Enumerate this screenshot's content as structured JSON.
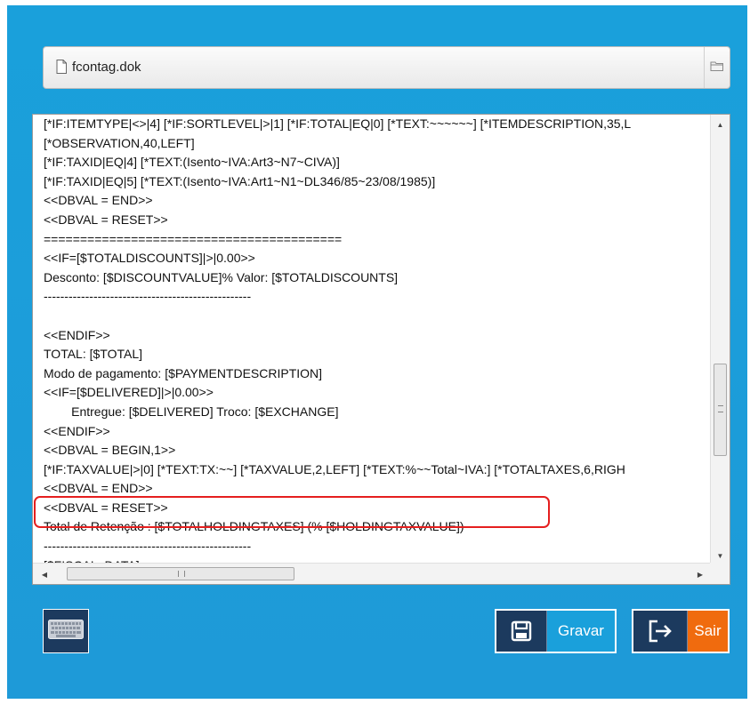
{
  "file_bar": {
    "filename": "fcontag.dok",
    "doc_icon": "document-icon",
    "folder_icon": "folder-icon"
  },
  "editor": {
    "lines": [
      "[*IF:ITEMTYPE|<>|4] [*IF:SORTLEVEL|>|1] [*IF:TOTAL|EQ|0] [*TEXT:~~~~~~] [*ITEMDESCRIPTION,35,L",
      "[*OBSERVATION,40,LEFT]",
      "[*IF:TAXID|EQ|4] [*TEXT:(Isento~IVA:Art3~N7~CIVA)]",
      "[*IF:TAXID|EQ|5] [*TEXT:(Isento~IVA:Art1~N1~DL346/85~23/08/1985)]",
      "<<DBVAL = END>>",
      "<<DBVAL = RESET>>",
      "=========================================",
      "<<IF=[$TOTALDISCOUNTS]|>|0.00>>",
      "Desconto: [$DISCOUNTVALUE]% Valor: [$TOTALDISCOUNTS]",
      "--------------------------------------------------",
      "",
      "<<ENDIF>>",
      "TOTAL: [$TOTAL]",
      "Modo de pagamento: [$PAYMENTDESCRIPTION]",
      "<<IF=[$DELIVERED]|>|0.00>>",
      "        Entregue: [$DELIVERED] Troco: [$EXCHANGE]",
      "<<ENDIF>>",
      "<<DBVAL = BEGIN,1>>",
      "[*IF:TAXVALUE|>|0] [*TEXT:TX:~~] [*TAXVALUE,2,LEFT] [*TEXT:%~~Total~IVA:] [*TOTALTAXES,6,RIGH",
      "<<DBVAL = END>>",
      "<<DBVAL = RESET>>",
      "Total de Retenção : [$TOTALHOLDINGTAXES] (% [$HOLDINGTAXVALUE])",
      "--------------------------------------------------",
      "[$FISCAL_DATA]"
    ]
  },
  "scrollbars": {
    "up_arrow": "▲",
    "down_arrow": "▼",
    "left_arrow": "◀",
    "right_arrow": "▶",
    "h_grip": "III"
  },
  "buttons": {
    "keyboard_icon": "keyboard-icon",
    "save_label": "Gravar",
    "save_icon": "floppy-disk-icon",
    "exit_label": "Sair",
    "exit_icon": "exit-icon"
  },
  "colors": {
    "background": "#1aa0db",
    "dark_button": "#1c3a5e",
    "save_accent": "#1aa0db",
    "exit_accent": "#f06b0e",
    "highlight": "#e51e1e"
  }
}
